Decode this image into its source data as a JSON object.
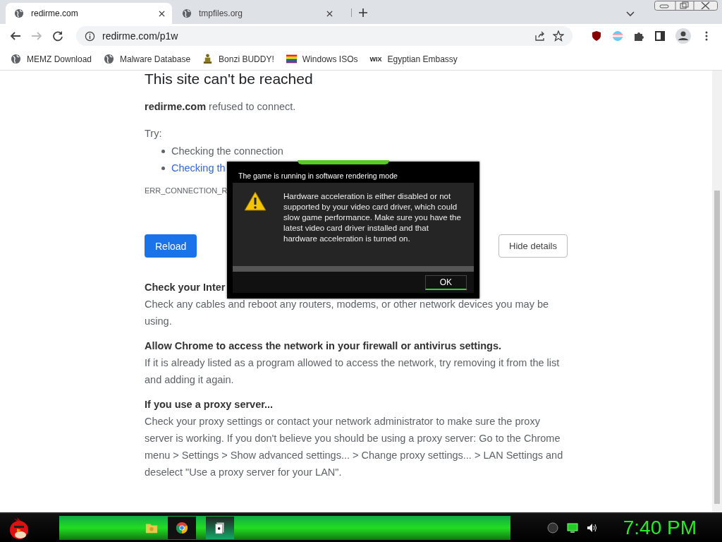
{
  "tabs": [
    {
      "title": "redirme.com",
      "selected": true
    },
    {
      "title": "tmpfiles.org",
      "selected": false
    }
  ],
  "address": {
    "url": "redirme.com/p1w"
  },
  "bookmarks": [
    {
      "label": "MEMZ Download",
      "kind": "globe"
    },
    {
      "label": "Malware Database",
      "kind": "globe"
    },
    {
      "label": "Bonzi BUDDY!",
      "kind": "figure"
    },
    {
      "label": "Windows ISOs",
      "kind": "flag"
    },
    {
      "label": "Egyptian Embassy",
      "kind": "wix",
      "icon_text": "WIX"
    }
  ],
  "error_page": {
    "heading": "This site can't be reached",
    "host": "redirme.com",
    "message": "refused to connect.",
    "try_label": "Try:",
    "suggestions": [
      {
        "text": "Checking the connection",
        "kind": "plain"
      },
      {
        "text": "Checking th",
        "kind": "link"
      }
    ],
    "error_code": "ERR_CONNECTION_R",
    "reload_button": "Reload",
    "details_button": "Hide details",
    "sections": [
      {
        "heading": "Check your Inter",
        "body": "Check any cables and reboot any routers, modems, or other network devices you may be using."
      },
      {
        "heading": "Allow Chrome to access the network in your firewall or antivirus settings.",
        "body": "If it is already listed as a program allowed to access the network, try removing it from the list and adding it again."
      },
      {
        "heading": "If you use a proxy server...",
        "body": "Check your proxy settings or contact your network administrator to make sure the proxy server is working. If you don't believe you should be using a proxy server: Go to the Chrome menu > Settings > Show advanced settings... > Change proxy settings... > LAN Settings and deselect \"Use a proxy server for your LAN\"."
      }
    ]
  },
  "dialog": {
    "title": "The game is running in software rendering mode",
    "message": "Hardware acceleration is either disabled or not supported by your video card driver, which could slow game performance. Make sure you have the latest video card driver installed and that hardware acceleration is turned on.",
    "ok_button": "OK"
  },
  "taskbar": {
    "clock": "7:40 PM"
  }
}
